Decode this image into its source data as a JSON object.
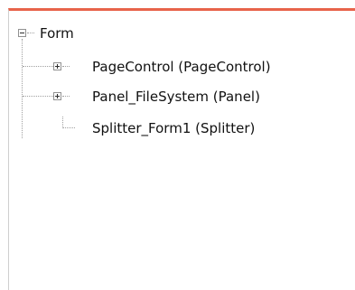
{
  "tree": {
    "root": {
      "label": "Form",
      "expander_icon": "minus-expander",
      "expanded": true
    },
    "children": [
      {
        "label": "PageControl (PageControl)",
        "expander_icon": "plus-expander",
        "expanded": false
      },
      {
        "label": "Panel_FileSystem (Panel)",
        "expander_icon": "plus-expander",
        "expanded": false
      },
      {
        "label": "Splitter_Form1 (Splitter)",
        "expander_icon": null,
        "expanded": false
      }
    ]
  },
  "colors": {
    "top_accent": "#e8634a"
  }
}
